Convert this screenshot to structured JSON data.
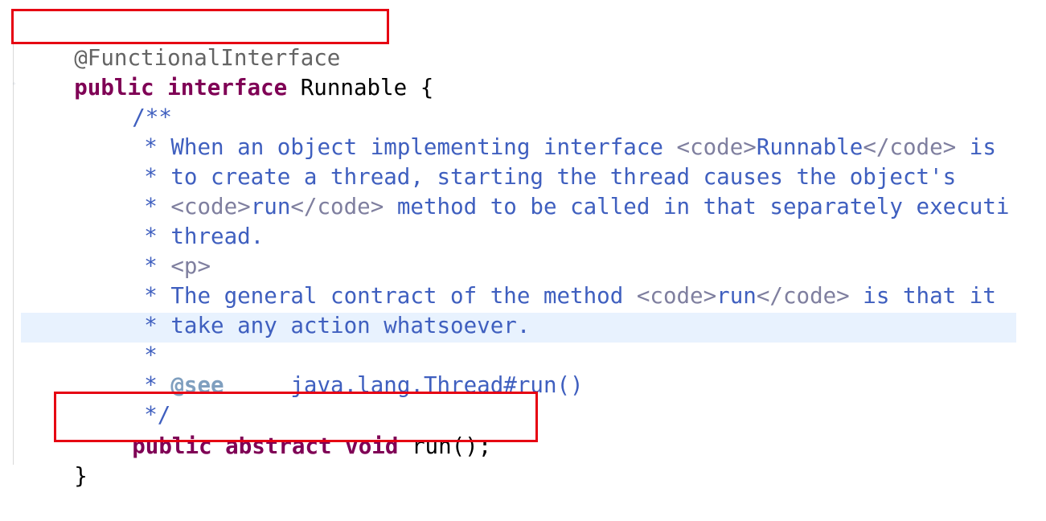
{
  "code": {
    "annotation": "@FunctionalInterface",
    "decl_public": "public",
    "decl_interface": "interface",
    "decl_name": "Runnable {",
    "doc_open": "/**",
    "doc1_star": "* ",
    "doc1_text": "When an object implementing interface ",
    "doc1_tag_open": "<code>",
    "doc1_code": "Runnable",
    "doc1_tag_close": "</code>",
    "doc1_tail": " is",
    "doc2": "* to create a thread, starting the thread causes the object's",
    "doc3_star": "* ",
    "doc3_tag_open": "<code>",
    "doc3_code": "run",
    "doc3_tag_close": "</code>",
    "doc3_tail": " method to be called in that separately executi",
    "doc4": "* thread.",
    "doc5_star": "* ",
    "doc5_tag": "<p>",
    "doc6_text": "* The general contract of the method ",
    "doc6_tag_open": "<code>",
    "doc6_code": "run",
    "doc6_tag_close": "</code>",
    "doc6_tail": " is that it",
    "doc7": "* take any action whatsoever.",
    "doc8": "*",
    "doc9_star": "* ",
    "doc9_see": "@see",
    "doc9_ref": "     java.lang.Thread#run()",
    "doc_close": "*/",
    "method_public": "public",
    "method_abstract": "abstract",
    "method_void": "void",
    "method_sig": "run();",
    "close_brace": "}"
  },
  "colors": {
    "keyword": "#7f0055",
    "javadoc": "#3f5fbf",
    "html_tag": "#7f7f9f",
    "annotation": "#646464",
    "highlight_box": "#e60012",
    "current_line": "#e8f2fe"
  }
}
